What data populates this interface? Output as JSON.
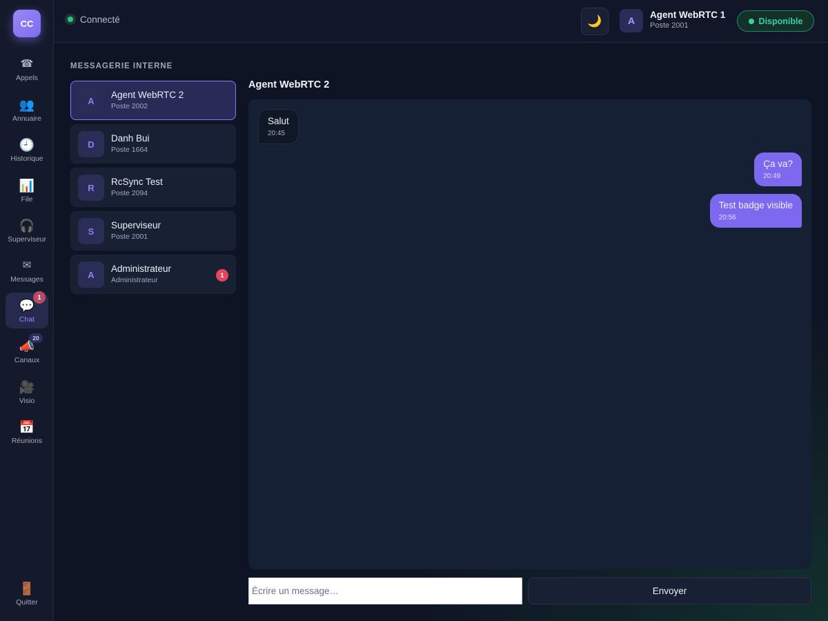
{
  "app": {
    "logo": "CC"
  },
  "sidebar": {
    "items": [
      {
        "label": "Appels",
        "icon": "phone-icon",
        "glyph": "☎"
      },
      {
        "label": "Annuaire",
        "icon": "contacts-icon",
        "glyph": "👥"
      },
      {
        "label": "Historique",
        "icon": "clock-icon",
        "glyph": "🕘"
      },
      {
        "label": "File",
        "icon": "bar-chart-icon",
        "glyph": "📊"
      },
      {
        "label": "Superviseur",
        "icon": "headset-icon",
        "glyph": "🎧"
      },
      {
        "label": "Messages",
        "icon": "envelope-icon",
        "glyph": "✉"
      },
      {
        "label": "Chat",
        "icon": "speech-bubble-icon",
        "glyph": "💬",
        "badge": "1",
        "active": true
      },
      {
        "label": "Canaux",
        "icon": "megaphone-icon",
        "glyph": "📣",
        "badge": "20"
      },
      {
        "label": "Visio",
        "icon": "video-camera-icon",
        "glyph": "🎥"
      },
      {
        "label": "Réunions",
        "icon": "calendar-icon",
        "glyph": "📅"
      }
    ],
    "quit": {
      "label": "Quitter",
      "icon": "door-icon",
      "glyph": "🚪"
    }
  },
  "header": {
    "connection_status": "Connecté",
    "theme_toggle_glyph": "🌙",
    "user": {
      "initial": "A",
      "name": "Agent WebRTC 1",
      "extension": "Poste 2001"
    },
    "availability": "Disponible"
  },
  "messaging": {
    "section_title": "MESSAGERIE INTERNE",
    "contacts": [
      {
        "initial": "A",
        "name": "Agent WebRTC 2",
        "sub": "Poste 2002",
        "active": true
      },
      {
        "initial": "D",
        "name": "Danh Bui",
        "sub": "Poste 1664"
      },
      {
        "initial": "R",
        "name": "RcSync Test",
        "sub": "Poste 2094"
      },
      {
        "initial": "S",
        "name": "Superviseur",
        "sub": "Poste 2001"
      },
      {
        "initial": "A",
        "name": "Administrateur",
        "sub": "Administrateur",
        "badge": "1"
      }
    ]
  },
  "chat": {
    "title": "Agent WebRTC 2",
    "messages": [
      {
        "direction": "in",
        "text": "Salut",
        "time": "20:45"
      },
      {
        "direction": "out",
        "text": "Ça va?",
        "time": "20:49"
      },
      {
        "direction": "out",
        "text": "Test badge visible",
        "time": "20:56"
      }
    ],
    "input_placeholder": "Écrire un message…",
    "send_label": "Envoyer"
  },
  "colors": {
    "accent": "#7d69ef",
    "status_green": "#35d39b",
    "badge_red": "#e5455f",
    "background": "#0f1424"
  }
}
